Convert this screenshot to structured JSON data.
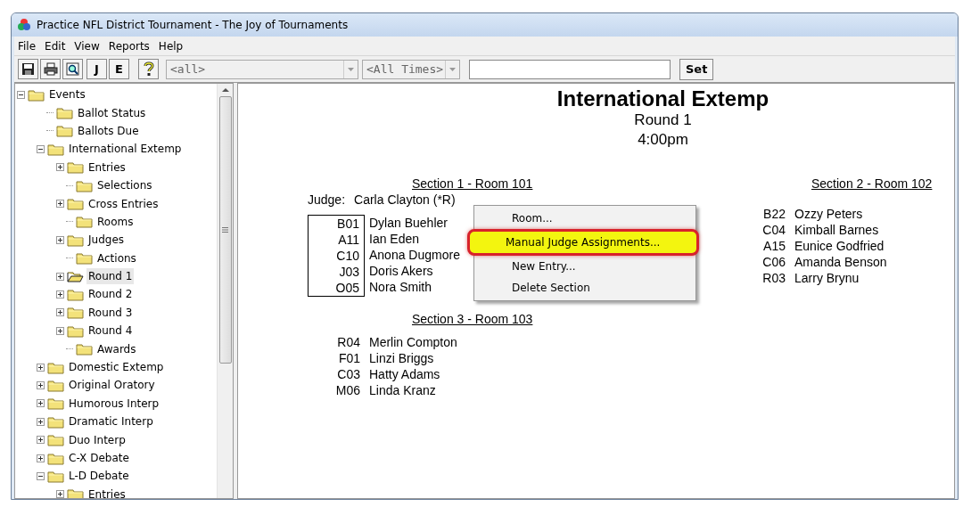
{
  "window": {
    "title": "Practice NFL District Tournament - The Joy of Tournaments"
  },
  "menu": [
    "File",
    "Edit",
    "View",
    "Reports",
    "Help"
  ],
  "toolbar": {
    "buttons": [
      {
        "kind": "save"
      },
      {
        "kind": "print"
      },
      {
        "kind": "preview"
      },
      {
        "kind": "text",
        "label": "J"
      },
      {
        "kind": "text",
        "label": "E"
      },
      {
        "kind": "help"
      }
    ],
    "event_filter": "<all>",
    "time_filter": "<All Times>",
    "set_button": "Set"
  },
  "tree": [
    {
      "label": "Events",
      "expanded": true,
      "selected": false,
      "children": [
        {
          "label": "Ballot Status",
          "selected": false
        },
        {
          "label": "Ballots Due",
          "selected": false
        },
        {
          "label": "International Extemp",
          "expanded": true,
          "selected": false,
          "children": [
            {
              "label": "Entries",
              "expanded": false,
              "selected": false
            },
            {
              "label": "Selections",
              "selected": false
            },
            {
              "label": "Cross Entries",
              "expanded": false,
              "selected": false
            },
            {
              "label": "Rooms",
              "selected": false
            },
            {
              "label": "Judges",
              "expanded": false,
              "selected": false
            },
            {
              "label": "Actions",
              "selected": false
            },
            {
              "label": "Round 1",
              "expanded": false,
              "selected": true
            },
            {
              "label": "Round 2",
              "expanded": false,
              "selected": false
            },
            {
              "label": "Round 3",
              "expanded": false,
              "selected": false
            },
            {
              "label": "Round 4",
              "expanded": false,
              "selected": false
            },
            {
              "label": "Awards",
              "selected": false
            }
          ]
        },
        {
          "label": "Domestic Extemp",
          "expanded": false,
          "selected": false
        },
        {
          "label": "Original Oratory",
          "expanded": false,
          "selected": false
        },
        {
          "label": "Humorous Interp",
          "expanded": false,
          "selected": false
        },
        {
          "label": "Dramatic Interp",
          "expanded": false,
          "selected": false
        },
        {
          "label": "Duo Interp",
          "expanded": false,
          "selected": false
        },
        {
          "label": "C-X Debate",
          "expanded": false,
          "selected": false
        },
        {
          "label": "L-D Debate",
          "expanded": true,
          "selected": false,
          "children": [
            {
              "label": "Entries",
              "expanded": false,
              "selected": false
            }
          ]
        }
      ]
    }
  ],
  "report": {
    "title": "International Extemp",
    "round": "Round 1",
    "time": "4:00pm",
    "sections": [
      {
        "heading": "Section 1 - Room 101",
        "judge_label": "Judge:",
        "judge": "Carla Clayton (*R)",
        "boxed": true,
        "entries": [
          {
            "code": "B01",
            "name": "Dylan Buehler"
          },
          {
            "code": "A11",
            "name": "Ian Eden"
          },
          {
            "code": "C10",
            "name": "Anona Dugmore"
          },
          {
            "code": "J03",
            "name": "Doris Akers"
          },
          {
            "code": "O05",
            "name": "Nora Smith"
          }
        ]
      },
      {
        "heading": "Section 2 - Room 102",
        "boxed": false,
        "entries": [
          {
            "code": "B22",
            "name": "Ozzy Peters"
          },
          {
            "code": "C04",
            "name": "Kimball Barnes"
          },
          {
            "code": "A15",
            "name": "Eunice Godfried"
          },
          {
            "code": "C06",
            "name": "Amanda Benson"
          },
          {
            "code": "R03",
            "name": "Larry Brynu"
          }
        ]
      },
      {
        "heading": "Section 3 - Room 103",
        "boxed": false,
        "entries": [
          {
            "code": "R04",
            "name": "Merlin Compton"
          },
          {
            "code": "F01",
            "name": "Linzi Briggs"
          },
          {
            "code": "C03",
            "name": "Hatty Adams"
          },
          {
            "code": "M06",
            "name": "Linda Kranz"
          }
        ]
      }
    ]
  },
  "context_menu": [
    {
      "label": "Room...",
      "selected": false
    },
    {
      "label": "Manual Judge Assignments...",
      "selected": true
    },
    {
      "label": "New Entry...",
      "selected": false
    },
    {
      "label": "Delete Section",
      "selected": false
    }
  ]
}
